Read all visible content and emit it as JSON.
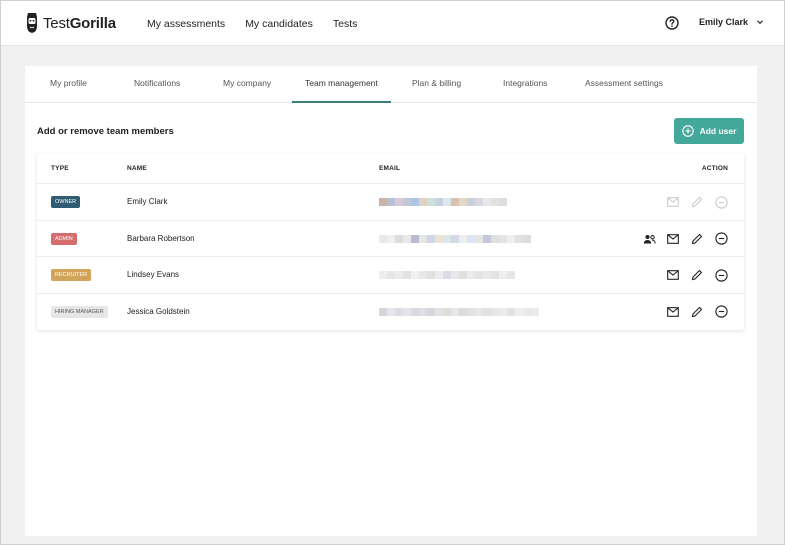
{
  "brand": {
    "name_light": "Test",
    "name_bold": "Gorilla"
  },
  "nav": {
    "items": [
      "My assessments",
      "My candidates",
      "Tests"
    ]
  },
  "user": {
    "name": "Emily Clark"
  },
  "tabs": [
    "My profile",
    "Notifications",
    "My company",
    "Team management",
    "Plan & billing",
    "Integrations",
    "Assessment settings"
  ],
  "active_tab": "Team management",
  "section": {
    "title": "Add or remove team members",
    "add_button": "Add user"
  },
  "table": {
    "headers": {
      "type": "TYPE",
      "name": "NAME",
      "email": "EMAIL",
      "action": "ACTION"
    },
    "rows": [
      {
        "type": "OWNER",
        "type_color": "#2f5e74",
        "name": "Emily Clark",
        "actions_enabled": false,
        "has_transfer": false
      },
      {
        "type": "ADMIN",
        "type_color": "#d46e6e",
        "name": "Barbara Robertson",
        "actions_enabled": true,
        "has_transfer": true
      },
      {
        "type": "RECRUITER",
        "type_color": "#d1a45a",
        "name": "Lindsey Evans",
        "actions_enabled": true,
        "has_transfer": false
      },
      {
        "type": "HIRING MANAGER",
        "type_color": "#e6e6e6",
        "name": "Jessica Goldstein",
        "actions_enabled": true,
        "has_transfer": false
      }
    ]
  },
  "colors": {
    "accent": "#43a89a",
    "tab_underline": "#3b7f7d"
  }
}
